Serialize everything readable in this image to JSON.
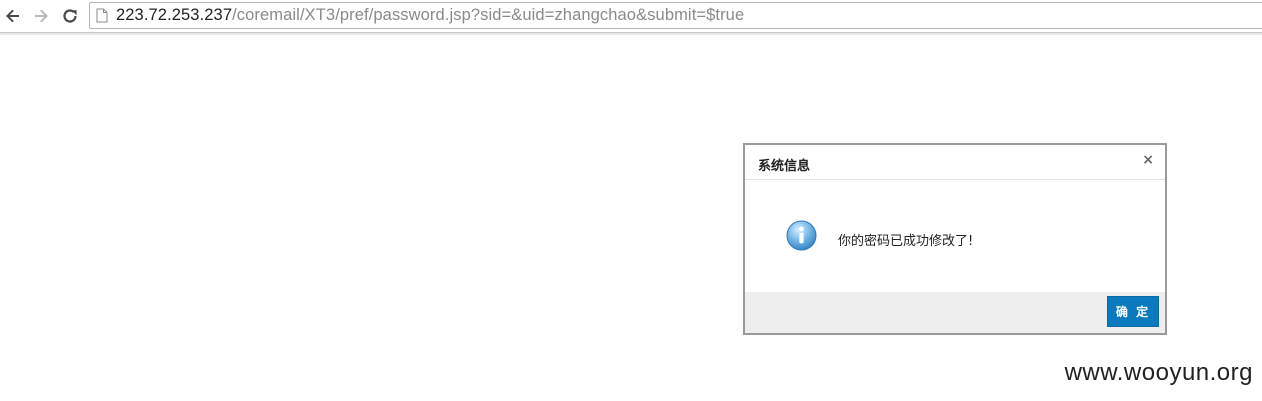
{
  "browser": {
    "url_host": "223.72.253.237",
    "url_path": "/coremail/XT3/pref/password.jsp?sid=&uid=zhangchao&submit=$true",
    "icons": {
      "back": "back-arrow-icon",
      "forward": "forward-arrow-icon",
      "reload": "reload-icon",
      "page": "page-icon"
    }
  },
  "dialog": {
    "title": "系统信息",
    "close_label": "×",
    "message": "你的密码已成功修改了!",
    "ok_label": "确 定",
    "icon": "info-icon"
  },
  "watermark": "www.wooyun.org",
  "colors": {
    "accent": "#0b79be",
    "footer": "#eeeeee"
  }
}
